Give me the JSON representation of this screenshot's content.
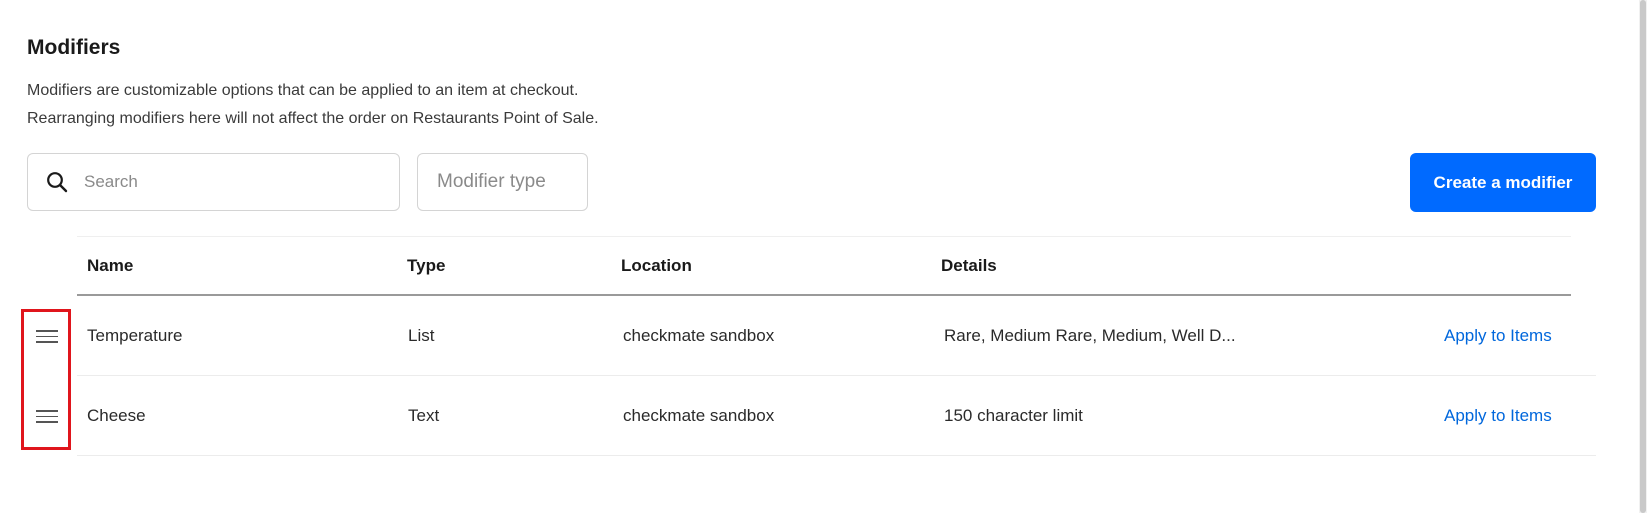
{
  "page": {
    "title": "Modifiers",
    "description_line1": "Modifiers are customizable options that can be applied to an item at checkout.",
    "description_line2": "Rearranging modifiers here will not affect the order on Restaurants Point of Sale."
  },
  "toolbar": {
    "search_placeholder": "Search",
    "search_value": "",
    "modifier_type_label": "Modifier type",
    "create_button_label": "Create a modifier"
  },
  "table": {
    "columns": [
      "Name",
      "Type",
      "Location",
      "Details"
    ],
    "rows": [
      {
        "name": "Temperature",
        "type": "List",
        "location": "checkmate sandbox",
        "details": "Rare, Medium Rare, Medium, Well D...",
        "action": "Apply to Items"
      },
      {
        "name": "Cheese",
        "type": "Text",
        "location": "checkmate sandbox",
        "details": "150 character limit",
        "action": "Apply to Items"
      }
    ]
  },
  "icons": {
    "search": "search-icon",
    "drag": "drag-handle-icon"
  },
  "colors": {
    "primary_button": "#006aff",
    "link": "#0067dc",
    "highlight": "#e0151c"
  }
}
